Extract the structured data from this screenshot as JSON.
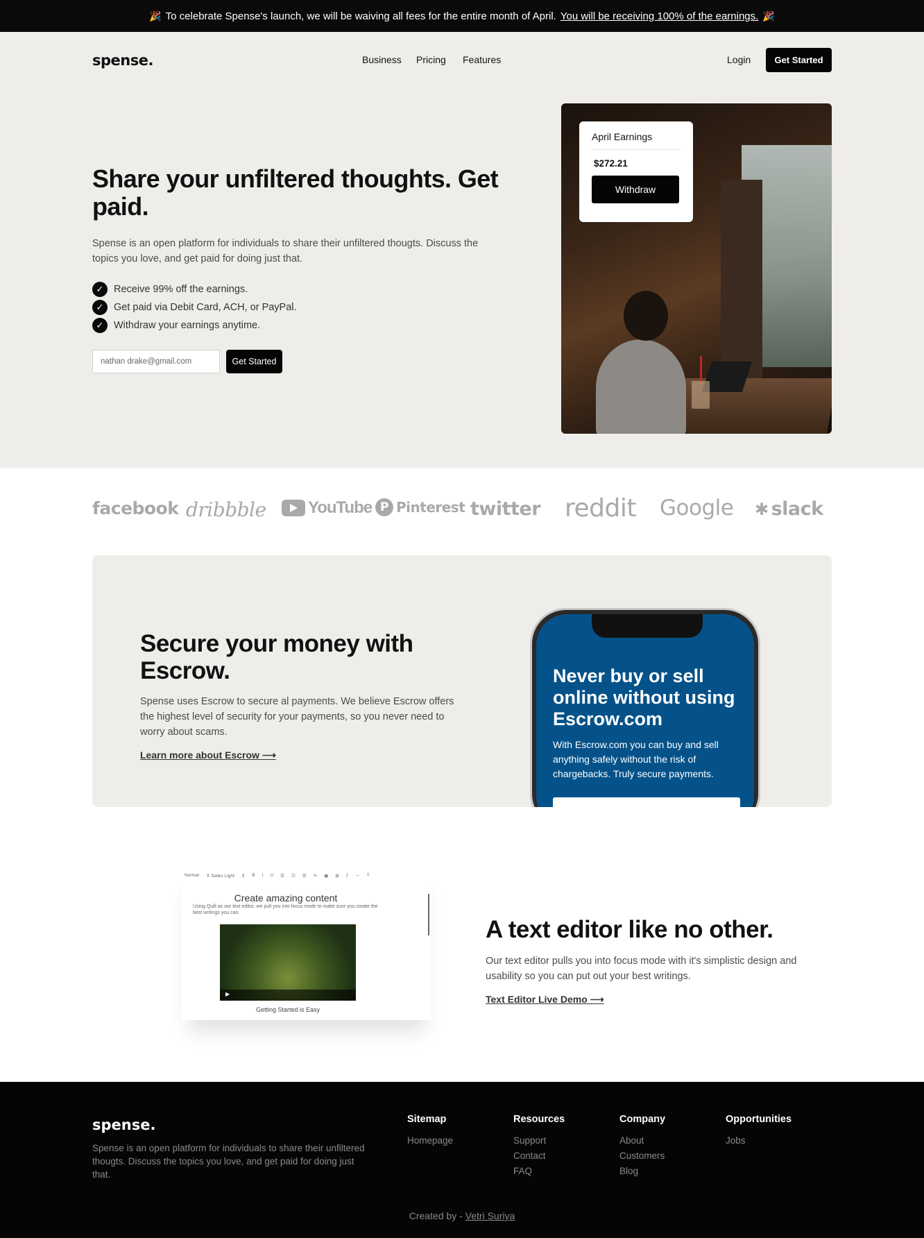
{
  "announcement": {
    "emoji_left": "🎉",
    "text": "To celebrate Spense's launch, we will be waiving all fees for the entire month of April.",
    "link": "You will be receiving 100% of the earnings.",
    "emoji_right": "🎉"
  },
  "header": {
    "logo": "spense.",
    "nav": [
      "Business",
      "Pricing",
      "Features"
    ],
    "login": "Login",
    "cta": "Get Started"
  },
  "hero": {
    "title": "Share your unfiltered thoughts. Get paid.",
    "description": "Spense is an open platform for individuals to share their unfiltered thougts. Discuss the topics you love, and get paid for doing just that.",
    "checks": [
      "Receive 99% off the earnings.",
      "Get paid via Debit Card, ACH, or PayPal.",
      "Withdraw your earnings anytime."
    ],
    "email_value": "nathan drake@gmail.com",
    "cta": "Get Started"
  },
  "earnings_card": {
    "title": "April Earnings",
    "amount": "$272.21",
    "button": "Withdraw"
  },
  "brands": [
    "facebook",
    "dribbble",
    "YouTube",
    "Pinterest",
    "twitter",
    "reddit",
    "Google",
    "slack"
  ],
  "escrow": {
    "title": "Secure your money with Escrow.",
    "description": "Spense uses Escrow to secure al payments. We believe Escrow offers the highest level of security for your payments, so you never need to worry about scams.",
    "link": "Learn more about Escrow ⟶",
    "phone_title": "Never buy or sell online without using Escrow.com",
    "phone_text": "With Escrow.com you can buy and sell anything safely without the risk of chargebacks. Truly secure payments."
  },
  "editor_preview": {
    "toolbar": [
      "Normal",
      "⇕ Sailec Light",
      "⇕",
      "B",
      "I",
      "U",
      "☰",
      "☷",
      "☰",
      "✎",
      "▣",
      "⊞",
      "ƒ",
      "⇔",
      "T"
    ],
    "title": "Create amazing content",
    "subtitle": "Using Quill as our text editor, we pull you into focus mode to make sure you create the best writings you can.",
    "caption": "Getting Started is Easy"
  },
  "editor": {
    "title": "A text editor like no other.",
    "description": "Our text editor pulls you into focus mode with it's simplistic design and usability so you can put out your best writings.",
    "link": "Text Editor Live Demo ⟶"
  },
  "footer": {
    "logo": "spense.",
    "description": "Spense is an open platform for individuals to share their unfiltered thougts. Discuss the topics you love, and get paid for doing just that.",
    "columns": [
      {
        "heading": "Sitemap",
        "items": [
          "Homepage"
        ]
      },
      {
        "heading": "Resources",
        "items": [
          "Support",
          "Contact",
          "FAQ"
        ]
      },
      {
        "heading": "Company",
        "items": [
          "About",
          "Customers",
          "Blog"
        ]
      },
      {
        "heading": "Opportunities",
        "items": [
          "Jobs"
        ]
      }
    ],
    "credit_prefix": "Created by -",
    "credit_name": "Vetri Suriya"
  },
  "colors": {
    "announcement_bg": "#0a0a0a",
    "hero_bg": "#efedea",
    "button_dark": "#050505",
    "escrow_phone_screen": "#05528a",
    "footer_bg": "#050505"
  }
}
